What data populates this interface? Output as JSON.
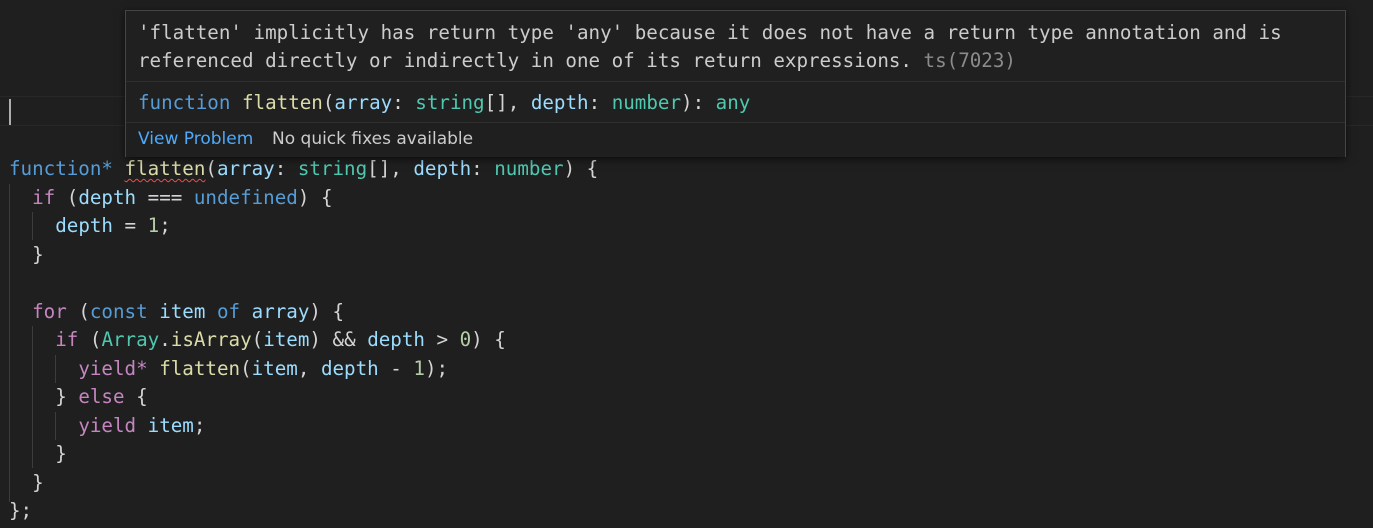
{
  "hover": {
    "message": "'flatten' implicitly has return type 'any' because it does not have a return type annotation and is referenced directly or indirectly in one of its return expressions.",
    "error_code": "ts(7023)",
    "signature": {
      "keyword": "function",
      "name": "flatten",
      "p1_name": "array",
      "p1_type": "string",
      "p1_suffix": "[]",
      "p2_name": "depth",
      "p2_type": "number",
      "return_type": "any"
    },
    "view_problem_label": "View Problem",
    "no_fixes_label": "No quick fixes available"
  },
  "code": {
    "l1": {
      "kw": "function*",
      "name": "flatten",
      "p1": "array",
      "t1": "string",
      "t1s": "[]",
      "p2": "depth",
      "t2": "number"
    },
    "l2": {
      "kw": "if",
      "var": "depth",
      "op": "===",
      "val": "undefined"
    },
    "l3": {
      "var": "depth",
      "op": "=",
      "num": "1"
    },
    "l4": {
      "close": "}"
    },
    "l6": {
      "kw": "for",
      "decl": "const",
      "var": "item",
      "of": "of",
      "arr": "array"
    },
    "l7": {
      "kw": "if",
      "cls": "Array",
      "method": "isArray",
      "arg": "item",
      "var": "depth",
      "num": "0"
    },
    "l8": {
      "kw": "yield*",
      "fn": "flatten",
      "arg1": "item",
      "arg2": "depth",
      "num": "1"
    },
    "l9": {
      "kw": "else"
    },
    "l10": {
      "kw": "yield",
      "var": "item"
    },
    "l11": {
      "close": "}"
    },
    "l12": {
      "close": "}"
    },
    "l13": {
      "close": "};"
    }
  },
  "colors": {
    "background": "#1f1f1f",
    "keyword": "#569cd6",
    "control": "#c586c0",
    "function": "#dcdcaa",
    "variable": "#9cdcfe",
    "type": "#4ec9b0",
    "number": "#b5cea8",
    "error_squiggle": "#f14c4c",
    "link": "#4daafc"
  }
}
